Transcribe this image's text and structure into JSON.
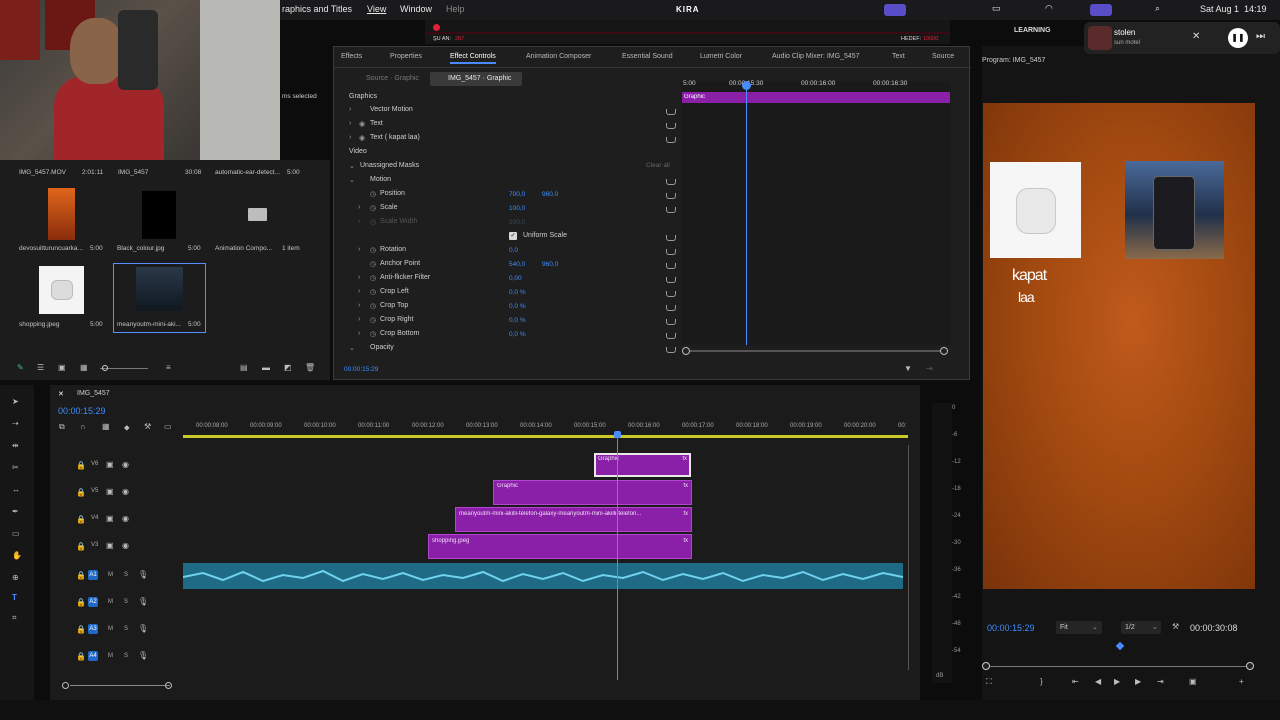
{
  "menubar": {
    "app_menu": "raphics and Titles",
    "view": "View",
    "window": "Window",
    "help": "Help",
    "title": "KIRA",
    "date": "Sat Aug 1",
    "time": "14:19",
    "sub_left_label": "ŞU AN:",
    "sub_left_value": "287",
    "sub_right_label": "HEDEF:",
    "sub_right_value": "10000"
  },
  "project_panel": {
    "items_selected": "ms selected",
    "row1": [
      {
        "name": "IMG_5457.MOV",
        "dur": "2:01:11"
      },
      {
        "name": "IMG_5457",
        "dur": "30:08"
      },
      {
        "name": "automatic-ear-detect...",
        "dur": "5:00"
      }
    ],
    "row2": [
      {
        "name": "devosuitturuncuarka...",
        "dur": "5:00"
      },
      {
        "name": "Black_colour.jpg",
        "dur": "5:00"
      },
      {
        "name": "Animation Compo...",
        "dur": "1 item"
      }
    ],
    "row3": [
      {
        "name": "shopping.jpeg",
        "dur": "5:00"
      },
      {
        "name": "meanyoutm-mini-aki...",
        "dur": "5:00"
      }
    ]
  },
  "effects_panel": {
    "tabs": [
      "Effects",
      "Properties",
      "Effect Controls",
      "Animation Composer",
      "Essential Sound",
      "Lumetri Color",
      "Audio Clip Mixer: IMG_5457",
      "Text",
      "Source"
    ],
    "source_label": "Source · Graphic",
    "target_label": "IMG_5457 · Graphic",
    "ruler": [
      "5:00",
      "00:00:15:30",
      "00:00:16:00",
      "00:00:16:30"
    ],
    "clip_label": "Graphic",
    "section_graphics": "Graphics",
    "vector_motion": "Vector Motion",
    "text1": "Text",
    "text2": "Text ( kapat laa)",
    "section_video": "Video",
    "unassigned_masks": "Unassigned Masks",
    "clear_all": "Clear all",
    "motion": "Motion",
    "position": "Position",
    "position_x": "700,0",
    "position_y": "960,0",
    "scale": "Scale",
    "scale_val": "100,0",
    "scale_width": "Scale Width",
    "scale_width_val": "100,0",
    "uniform_scale": "Uniform Scale",
    "rotation": "Rotation",
    "rotation_val": "0,0",
    "anchor": "Anchor Point",
    "anchor_x": "540,0",
    "anchor_y": "960,0",
    "antiflicker": "Anti-flicker Filter",
    "antiflicker_val": "0,00",
    "crop_left": "Crop Left",
    "crop_left_val": "0,0 %",
    "crop_top": "Crop Top",
    "crop_top_val": "0,0 %",
    "crop_right": "Crop Right",
    "crop_right_val": "0,0 %",
    "crop_bottom": "Crop Bottom",
    "crop_bottom_val": "0,0 %",
    "opacity": "Opacity",
    "timecode": "00:00:15:29"
  },
  "program": {
    "title": "Program: IMG_5457",
    "learning": "LEARNING",
    "music_title": "stolen",
    "music_artist": "sun motel",
    "overlay_text_line1": "kapat",
    "overlay_text_line2": "laa",
    "timecode": "00:00:15:29",
    "fit": "Fit",
    "quality": "1/2",
    "duration": "00:00:30:08"
  },
  "timeline": {
    "sequence": "IMG_5457",
    "timecode": "00:00:15:29",
    "ruler": [
      "00:00:08:00",
      "00:00:09:00",
      "00:00:10:00",
      "00:00:11:00",
      "00:00:12:00",
      "00:00:13:00",
      "00:00:14:00",
      "00:00:15:00",
      "00:00:16:00",
      "00:00:17:00",
      "00:00:18:00",
      "00:00:19:00",
      "00:00:20:00",
      "00:"
    ],
    "video_tracks": [
      "V6",
      "V5",
      "V4",
      "V3"
    ],
    "audio_tracks": [
      "A1",
      "A2",
      "A3",
      "A4"
    ],
    "clip_v6": "Graphic",
    "clip_v5": "Graphic",
    "clip_v4": "meanyoutm-mini-akilli-telefon-galaxy-meanyoutm-mini-akilli-telefon...",
    "clip_v3": "shopping.jpeg",
    "fx": "fx",
    "mute": "M",
    "solo": "S",
    "meter_labels": [
      "0",
      "-6",
      "-12",
      "-18",
      "-24",
      "-30",
      "-36",
      "-42",
      "-48",
      "-54",
      "dB"
    ]
  },
  "colors": {
    "clip": "#8a1fa8",
    "audio": "#1f6b86",
    "accent": "#3d8eff",
    "playhead": "#4a8cff"
  }
}
